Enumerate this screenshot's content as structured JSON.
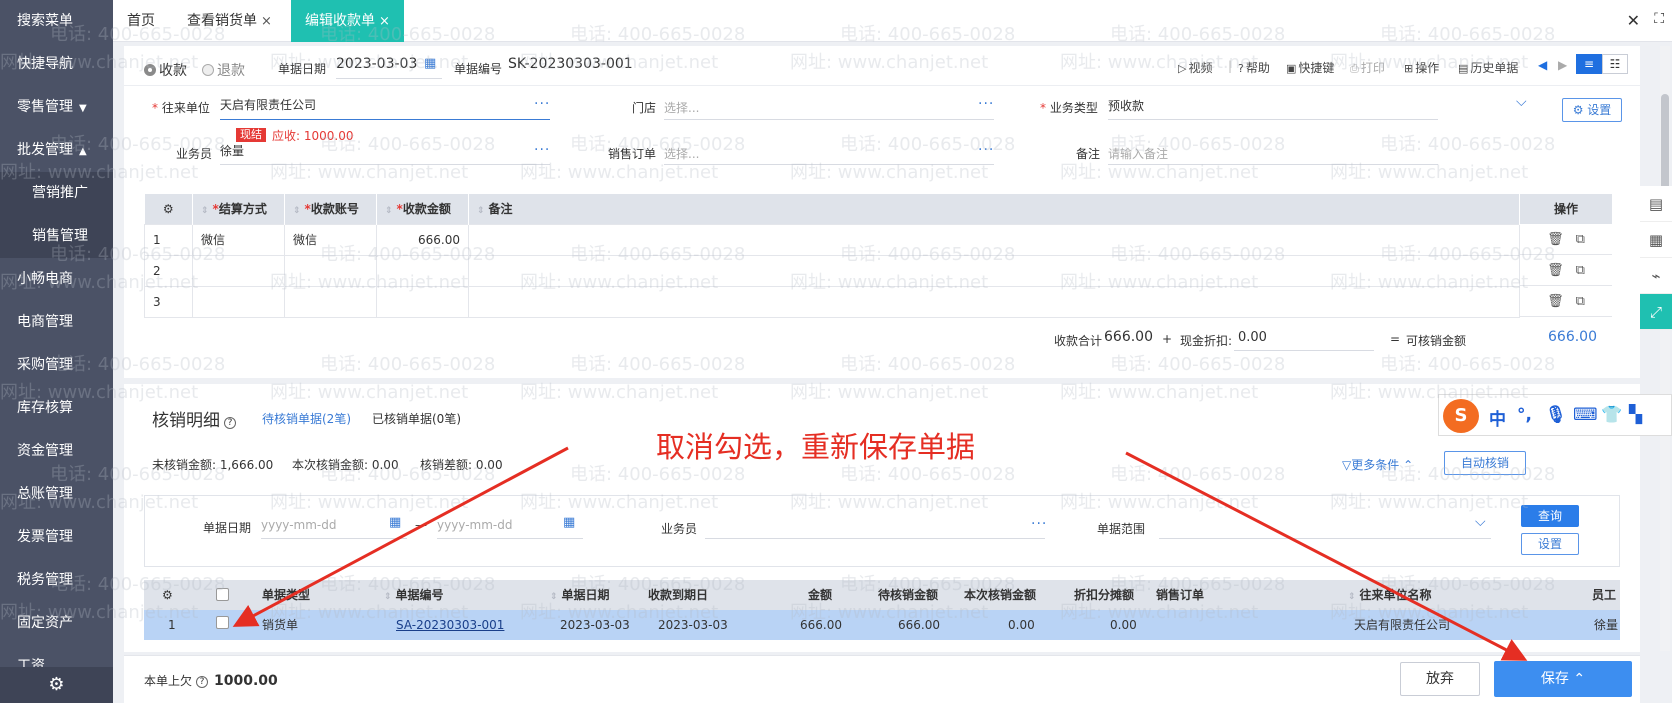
{
  "sidebar": {
    "items": [
      {
        "label": "搜索菜单"
      },
      {
        "label": "快捷导航"
      },
      {
        "label": "零售管理",
        "arrow": "▼"
      },
      {
        "label": "批发管理",
        "arrow": "▲"
      },
      {
        "label": "营销推广"
      },
      {
        "label": "销售管理"
      },
      {
        "label": "小畅电商"
      },
      {
        "label": "电商管理"
      },
      {
        "label": "采购管理"
      },
      {
        "label": "库存核算"
      },
      {
        "label": "资金管理"
      },
      {
        "label": "总账管理"
      },
      {
        "label": "发票管理"
      },
      {
        "label": "税务管理"
      },
      {
        "label": "固定资产"
      },
      {
        "label": "工资"
      }
    ],
    "settings_icon": "gear-icon"
  },
  "tabs": [
    {
      "label": "首页"
    },
    {
      "label": "查看销货单"
    },
    {
      "label": "编辑收款单",
      "active": true
    }
  ],
  "form": {
    "radio_receive": "收款",
    "radio_refund": "退款",
    "doc_date_label": "单据日期",
    "doc_date": "2023-03-03",
    "doc_no_label": "单据编号",
    "doc_no": "SK-20230303-001",
    "toolbar": {
      "video": "视频",
      "help": "帮助",
      "shortcut": "快捷键",
      "print": "打印",
      "operate": "操作",
      "history": "历史单据"
    },
    "partner_label": "往来单位",
    "partner_value": "天启有限责任公司",
    "now_badge": "现结",
    "receivable": "应收: 1000.00",
    "store_label": "门店",
    "select_placeholder": "选择...",
    "biz_type_label": "业务类型",
    "biz_type_value": "预收款",
    "settings": "设置",
    "salesman_label": "业务员",
    "salesman_value": "徐量",
    "sales_order_label": "销售订单",
    "remark_label": "备注",
    "remark_placeholder": "请输入备注"
  },
  "detail_table": {
    "headers": [
      "结算方式",
      "收款账号",
      "收款金额",
      "备注"
    ],
    "ops_header": "操作",
    "rows": [
      {
        "no": "1",
        "method": "微信",
        "account": "微信",
        "amount": "666.00",
        "remark": ""
      },
      {
        "no": "2",
        "method": "",
        "account": "",
        "amount": "",
        "remark": ""
      },
      {
        "no": "3",
        "method": "",
        "account": "",
        "amount": "",
        "remark": ""
      }
    ]
  },
  "totals": {
    "sum_label": "收款合计",
    "sum_value": "666.00",
    "plus": "+",
    "discount_label": "现金折扣:",
    "discount_value": "0.00",
    "equals": "=",
    "avail_label": "可核销金额",
    "avail_value": "666.00"
  },
  "verify": {
    "title": "核销明细",
    "tab_pending": "待核销单据(2笔)",
    "tab_done": "已核销单据(0笔)",
    "unverified": "未核销金额: 1,666.00",
    "this_time": "本次核销金额: 0.00",
    "diff": "核销差额: 0.00",
    "more_cond": "更多条件",
    "auto_btn": "自动核销",
    "filter": {
      "date_label": "单据日期",
      "date_placeholder": "yyyy-mm-dd",
      "dash": "—",
      "salesman_label": "业务员",
      "range_label": "单据范围",
      "query_btn": "查询",
      "setting_btn": "设置"
    },
    "list_headers": [
      "单据类型",
      "单据编号",
      "单据日期",
      "收款到期日",
      "金额",
      "待核销金额",
      "本次核销金额",
      "折扣分摊额",
      "销售订单",
      "往来单位名称",
      "员工"
    ],
    "rows": [
      {
        "no": "1",
        "type": "销货单",
        "doc_no": "SA-20230303-001",
        "date": "2023-03-03",
        "due": "2023-03-03",
        "amount": "666.00",
        "pending": "666.00",
        "this_time": "0.00",
        "discount": "0.00",
        "order": "",
        "partner": "天启有限责任公司",
        "staff": "徐量"
      }
    ]
  },
  "footer": {
    "prev_owe_label": "本单上欠",
    "prev_owe_value": "1000.00",
    "giveup": "放弃",
    "save": "保存"
  },
  "annotation": "取消勾选，重新保存单据",
  "watermark": {
    "phone": "电话: 400-665-0028",
    "site": "网址: www.chanjet.net"
  },
  "colors": {
    "sidebar": "#4b5266",
    "active_tab": "#1fc0b1",
    "primary": "#3d8ef0",
    "danger": "#e53935",
    "annotation": "#e52e23",
    "selected_row": "#b9d3f5"
  }
}
